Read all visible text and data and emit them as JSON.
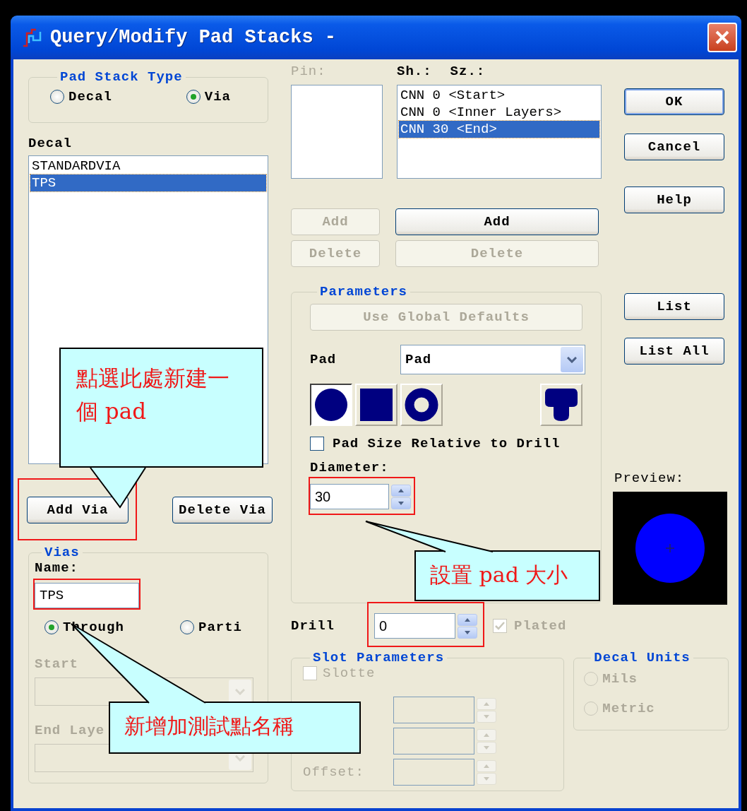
{
  "window": {
    "title": "Query/Modify Pad Stacks -"
  },
  "pad_stack_type": {
    "label": "Pad Stack Type",
    "options": [
      {
        "label": "Decal",
        "selected": false
      },
      {
        "label": "Via",
        "selected": true
      }
    ]
  },
  "decal": {
    "label": "Decal",
    "items": [
      {
        "label": "STANDARDVIA",
        "selected": false
      },
      {
        "label": "TPS",
        "selected": true
      }
    ]
  },
  "via_buttons": [
    {
      "label": "Add Via",
      "highlighted": true
    },
    {
      "label": "Delete Via",
      "highlighted": false
    }
  ],
  "vias": {
    "label": "Vias",
    "name_label": "Name:",
    "name_value": "TPS",
    "name_highlighted": true,
    "options": [
      {
        "label": "Through",
        "selected": true
      },
      {
        "label": "Parti",
        "selected": false
      }
    ],
    "start_label": "Start",
    "end_label": "End Laye",
    "disabled": true
  },
  "pin": {
    "label": "Pin:",
    "disabled": true
  },
  "layers": {
    "labels": [
      "Sh.:",
      "Sz.:"
    ],
    "items": [
      {
        "label": "CNN 0 <Start>",
        "selected": false
      },
      {
        "label": "CNN 0 <Inner Layers>",
        "selected": false
      },
      {
        "label": "CNN 30 <End>",
        "selected": true
      }
    ]
  },
  "pin_buttons": [
    {
      "label": "Add",
      "disabled": true
    },
    {
      "label": "Delete",
      "disabled": true
    }
  ],
  "layer_buttons": [
    {
      "label": "Add",
      "disabled": false
    },
    {
      "label": "Delete",
      "disabled": true
    }
  ],
  "parameters": {
    "label": "Parameters",
    "defaults_button": {
      "label": "Use Global Defaults",
      "disabled": true
    },
    "pad_label": "Pad",
    "pad_select": "Pad",
    "shapes": [
      {
        "kind": "round",
        "selected": true
      },
      {
        "kind": "square",
        "selected": false
      },
      {
        "kind": "annular",
        "selected": false
      },
      {
        "kind": "custom",
        "selected": false
      }
    ],
    "relative": {
      "label": "Pad Size Relative to Drill",
      "checked": false
    },
    "diameter_label": "Diameter:",
    "diameter": "30",
    "diameter_highlighted": true
  },
  "drill": {
    "label": "Drill",
    "value": "0",
    "highlighted": true,
    "plated": {
      "label": "Plated",
      "checked": true,
      "disabled": true
    }
  },
  "slot": {
    "label": "Slot Parameters",
    "disabled": true,
    "slotted": {
      "label": "Slotte",
      "checked": false
    },
    "offset_label": "Offset:"
  },
  "decal_units": {
    "label": "Decal Units",
    "disabled": true,
    "options": [
      {
        "label": "Mils",
        "selected": false
      },
      {
        "label": "Metric",
        "selected": false
      }
    ]
  },
  "buttons": [
    {
      "label": "OK",
      "default": true
    },
    {
      "label": "Cancel",
      "default": false
    },
    {
      "label": "Help",
      "default": false
    },
    {
      "label": "List",
      "default": false
    },
    {
      "label": "List All",
      "default": false
    }
  ],
  "preview": {
    "label": "Preview:"
  },
  "callouts": [
    {
      "text": "點選此處新建一個 pad"
    },
    {
      "text": "設置 pad 大小"
    },
    {
      "text": "新增加測試點名稱"
    }
  ]
}
